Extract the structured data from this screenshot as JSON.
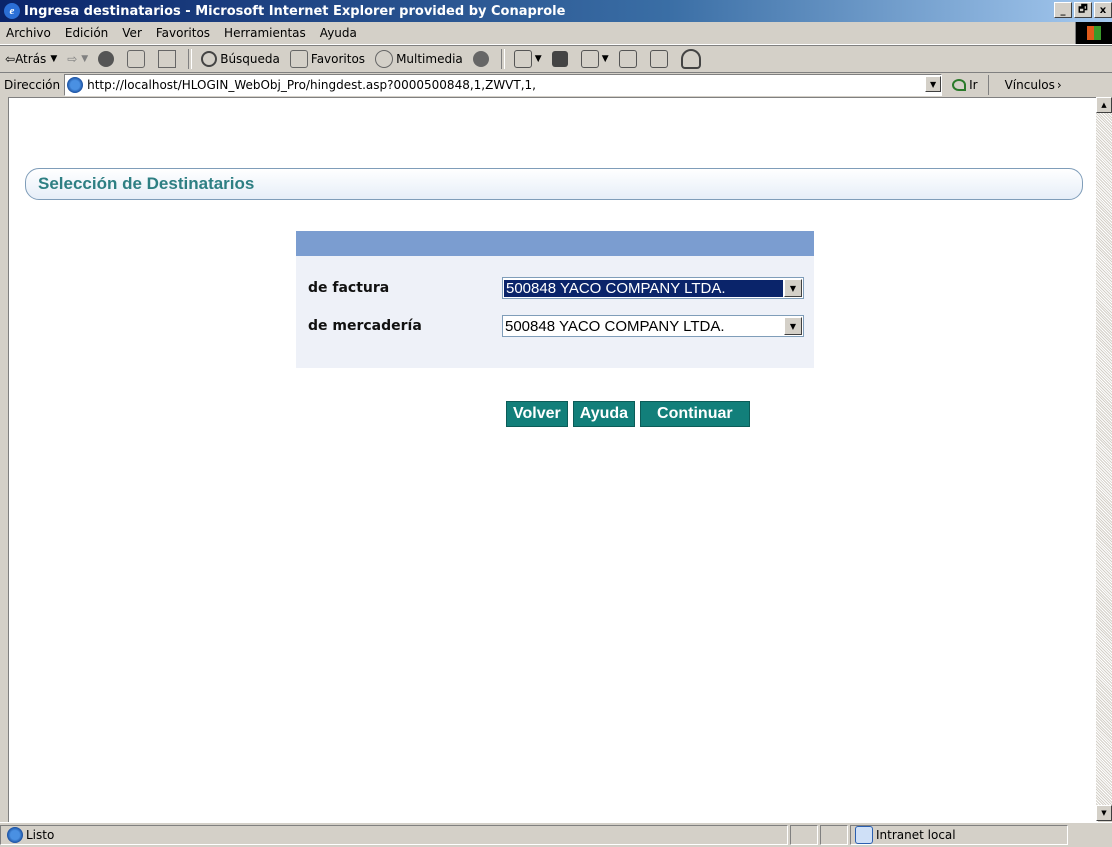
{
  "window": {
    "title": "Ingresa destinatarios - Microsoft Internet Explorer provided by Conaprole",
    "btn_min": "_",
    "btn_max": "🗗",
    "btn_close": "x"
  },
  "menu": [
    "Archivo",
    "Edición",
    "Ver",
    "Favoritos",
    "Herramientas",
    "Ayuda"
  ],
  "toolbar": {
    "back": "Atrás",
    "search": "Búsqueda",
    "favorites": "Favoritos",
    "media": "Multimedia"
  },
  "address": {
    "label": "Dirección",
    "url": "http://localhost/HLOGIN_WebObj_Pro/hingdest.asp?0000500848,1,ZWVT,1,",
    "go": "Ir",
    "links": "Vínculos"
  },
  "page": {
    "section_title": "Selección de Destinatarios",
    "fields": [
      {
        "label": "de factura",
        "value": "500848 YACO COMPANY LTDA."
      },
      {
        "label": "de mercadería",
        "value": "500848 YACO COMPANY LTDA."
      }
    ],
    "buttons": {
      "back": "Volver",
      "help": "Ayuda",
      "continue": "Continuar"
    }
  },
  "status": {
    "text": "Listo",
    "zone": "Intranet local"
  },
  "colors": {
    "accent_teal": "#127f7a",
    "panel_header": "#7b9dd0",
    "section_title": "#2e7f83"
  }
}
